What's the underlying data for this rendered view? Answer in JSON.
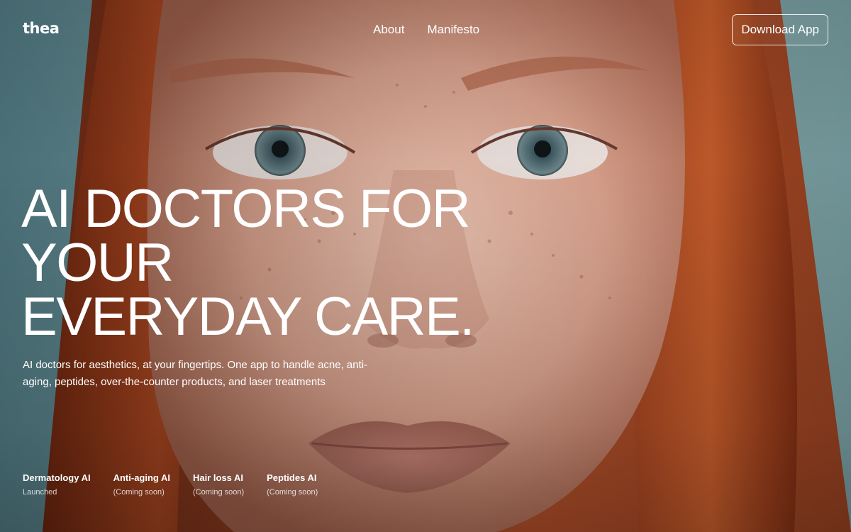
{
  "brand": {
    "logo_text": "thea"
  },
  "nav": {
    "links": [
      {
        "label": "About"
      },
      {
        "label": "Manifesto"
      }
    ],
    "cta_label": "Download App"
  },
  "hero": {
    "headline_lines": [
      "AI DOCTORS FOR",
      "YOUR",
      "EVERYDAY CARE."
    ],
    "subtitle": "AI doctors for aesthetics, at your fingertips. One app to handle acne, anti-aging, peptides, over-the-counter products, and laser treatments"
  },
  "products": [
    {
      "name": "Dermatology AI",
      "status": "Launched"
    },
    {
      "name": "Anti-aging AI",
      "status": "(Coming soon)"
    },
    {
      "name": "Hair loss AI",
      "status": "(Coming soon)"
    },
    {
      "name": "Peptides AI",
      "status": "(Coming soon)"
    }
  ],
  "colors": {
    "text": "#ffffff",
    "background_teal": "#7f9aa0",
    "hair": "#9a3a1c",
    "skin": "#e6b6a4"
  },
  "icons": [
    "hero-background-photo"
  ]
}
